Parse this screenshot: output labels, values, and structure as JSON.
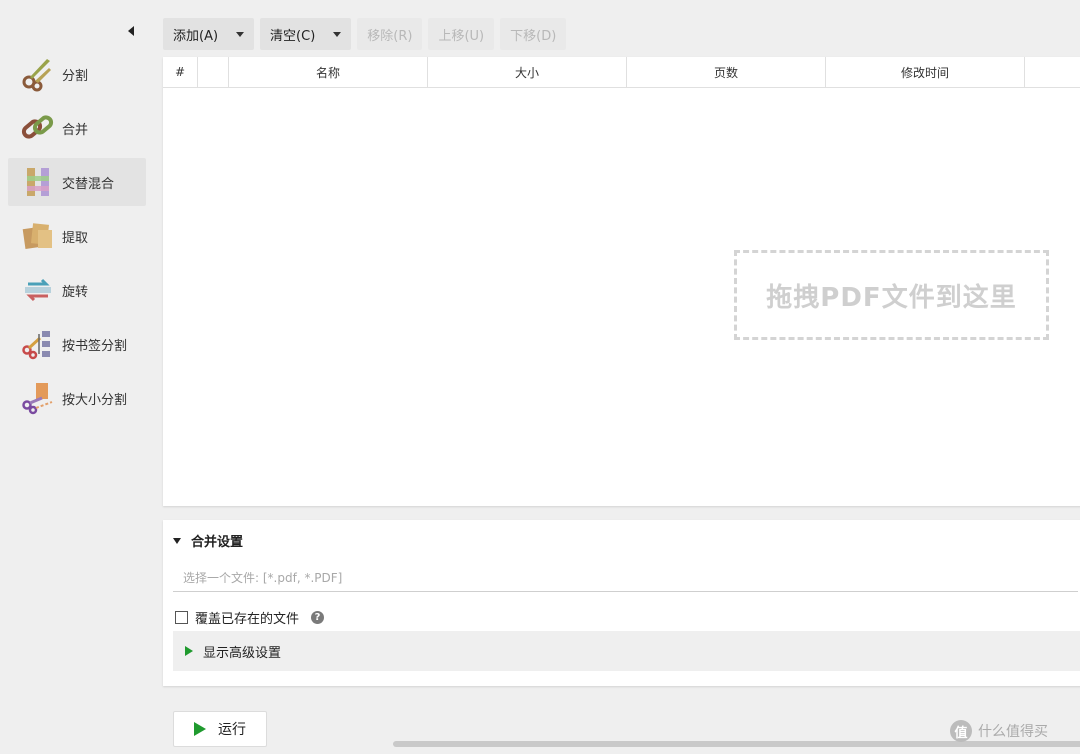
{
  "sidebar": {
    "collapse_icon": "collapse-left-icon",
    "items": [
      {
        "label": "分割",
        "icon": "scissors-split-icon",
        "active": false
      },
      {
        "label": "合并",
        "icon": "chain-link-merge-icon",
        "active": false
      },
      {
        "label": "交替混合",
        "icon": "alternate-mix-icon",
        "active": true
      },
      {
        "label": "提取",
        "icon": "extract-pages-icon",
        "active": false
      },
      {
        "label": "旋转",
        "icon": "rotate-icon",
        "active": false
      },
      {
        "label": "按书签分割",
        "icon": "split-by-bookmark-icon",
        "active": false
      },
      {
        "label": "按大小分割",
        "icon": "split-by-size-icon",
        "active": false
      }
    ]
  },
  "toolbar": {
    "add_label": "添加(A)",
    "clear_label": "清空(C)",
    "remove_label": "移除(R)",
    "move_up_label": "上移(U)",
    "move_down_label": "下移(D)"
  },
  "table": {
    "columns": [
      "#",
      "",
      "名称",
      "大小",
      "页数",
      "修改时间",
      ""
    ],
    "rows": [],
    "dropzone_text": "拖拽PDF文件到这里"
  },
  "settings": {
    "title": "合并设置",
    "destination_placeholder": "选择一个文件: [*.pdf, *.PDF]",
    "destination_value": "",
    "overwrite_label": "覆盖已存在的文件",
    "overwrite_checked": false,
    "help_symbol": "?",
    "advanced_label": "显示高级设置"
  },
  "run": {
    "label": "运行"
  },
  "watermark": {
    "text": "什么值得买",
    "logo_glyph": "值"
  },
  "colors": {
    "accent_green": "#1f9a2e",
    "panel_bg": "#ffffff",
    "app_bg": "#efefef"
  }
}
